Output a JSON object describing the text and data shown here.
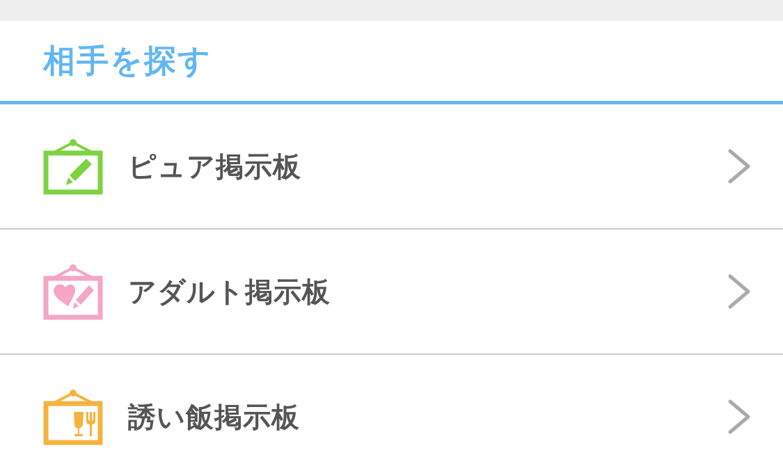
{
  "section": {
    "title": "相手を探す"
  },
  "items": [
    {
      "label": "ピュア掲示板",
      "kind": "pencil",
      "color": "#7dd33f"
    },
    {
      "label": "アダルト掲示板",
      "kind": "heart",
      "color": "#f4a6c4"
    },
    {
      "label": "誘い飯掲示板",
      "kind": "meal",
      "color": "#f5b33e"
    }
  ]
}
